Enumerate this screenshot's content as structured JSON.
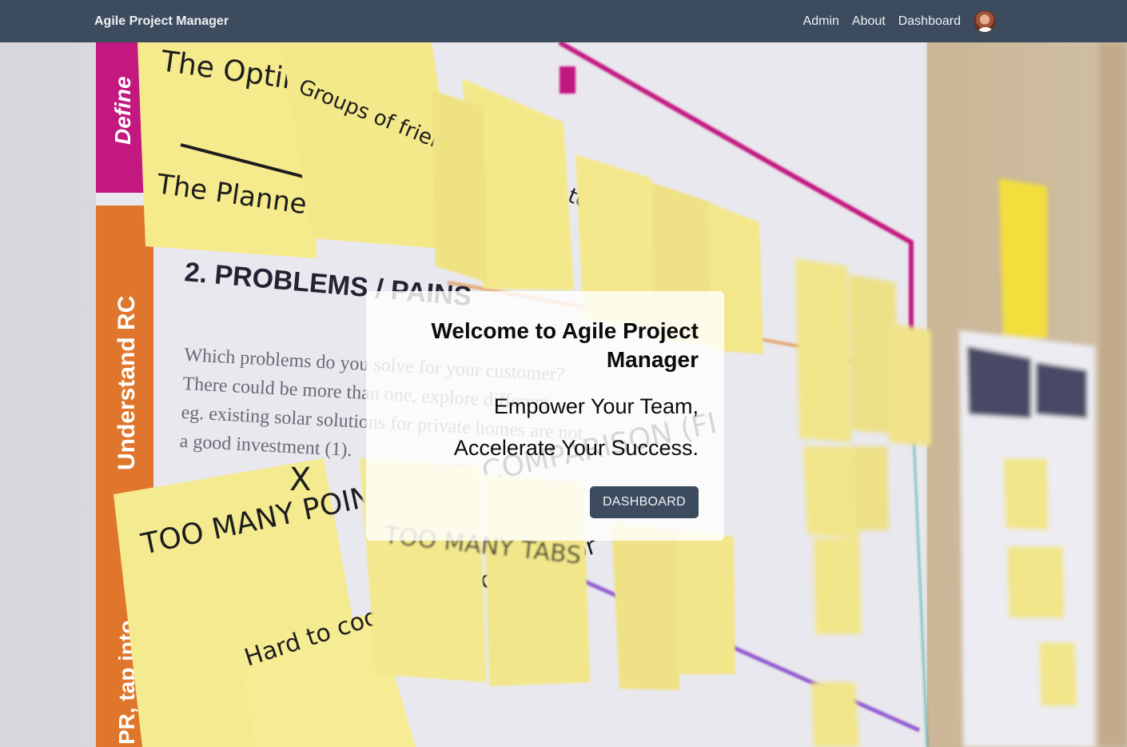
{
  "navbar": {
    "brand": "Agile Project Manager",
    "links": [
      {
        "label": "Admin"
      },
      {
        "label": "About"
      },
      {
        "label": "Dashboard"
      }
    ],
    "avatar_icon": "user-avatar-icon",
    "background_color": "#3d4b5e"
  },
  "hero": {
    "background_image": "whiteboard-sticky-notes-photo",
    "board_text": {
      "define": "Define",
      "understand": "Understand RC",
      "pr_tap": "PR, tap into",
      "problems_heading": "2. PROBLEMS / PAINS",
      "problems_lines": [
        "Which problems do you solve for your customer?",
        "There could be more than one, explore different...",
        "eg. existing solar solutions for private homes are not",
        "a good investment (1)."
      ],
      "notes": {
        "optimizer": "The Optimizer",
        "planner": "The Planner",
        "friends": "Groups of friends travelling together",
        "too_many_points": "TOO MANY POINTS FOR COMPARISON (FI",
        "hard_to_coordinate": "Hard to coordinate booking for",
        "too_many_tabs": "TOO MANY TABS",
        "x_mark": "X"
      }
    }
  },
  "card": {
    "title": "Welcome to Agile Project Manager",
    "tagline_line1": "Empower Your Team,",
    "tagline_line2": "Accelerate Your Success.",
    "button_label": "DASHBOARD",
    "button_color": "#3d4b5e"
  }
}
